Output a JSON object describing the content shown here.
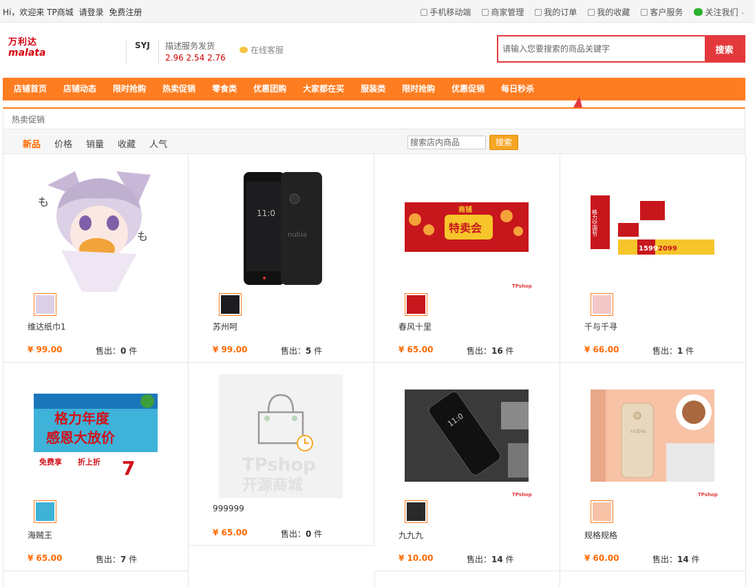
{
  "topbar": {
    "welcome": "Hi，欢迎来 TP商城",
    "login": "请登录",
    "register": "免费注册",
    "links": [
      "手机移动端",
      "商家管理",
      "我的订单",
      "我的收藏",
      "客户服务",
      "关注我们"
    ]
  },
  "header": {
    "logo_cn": "万利达",
    "logo_en": "malata",
    "shop_name": "SYJ",
    "score_label": "描述服务发货",
    "score_values": "2.96 2.54 2.76",
    "kefu": "在线客服",
    "search_placeholder": "请输入您要搜索的商品关键字",
    "search_button": "搜索"
  },
  "nav": [
    "店铺首页",
    "店铺动态",
    "限时抢购",
    "热卖促销",
    "零食类",
    "优惠团购",
    "大家都在买",
    "服装类",
    "限时抢购",
    "优惠促销",
    "每日秒杀"
  ],
  "section_tab": "热卖促销",
  "sort": {
    "options": [
      "新品",
      "价格",
      "销量",
      "收藏",
      "人气"
    ],
    "shop_search_placeholder": "搜索店内商品",
    "shop_search_button": "搜索"
  },
  "sold_label": "售出：",
  "sold_unit": " 件",
  "products": [
    {
      "name": "维达纸巾1",
      "price": "¥ 99.00",
      "sold": "0"
    },
    {
      "name": "苏州呵",
      "price": "¥ 99.00",
      "sold": "5"
    },
    {
      "name": "春风十里",
      "price": "¥ 65.00",
      "sold": "16"
    },
    {
      "name": "千与千寻",
      "price": "¥ 66.00",
      "sold": "1"
    },
    {
      "name": "海贼王",
      "price": "¥ 65.00",
      "sold": "7"
    },
    {
      "name": "999999",
      "price": "¥ 65.00",
      "sold": "0"
    },
    {
      "name": "九九九",
      "price": "¥ 10.00",
      "sold": "14"
    },
    {
      "name": "规格规格",
      "price": "¥ 60.00",
      "sold": "14"
    }
  ],
  "images": {
    "p3_banner_top": "商铺",
    "p3_banner_main": "特卖会",
    "p4_banner": "格力空调节",
    "p4_prices": [
      "1599",
      "2099"
    ],
    "p5_line1": "格力年度",
    "p5_line2": "感恩大放价",
    "p5_left": "免费享",
    "p5_mid": "折上折",
    "p5_num": "7",
    "p6_brand": "TPshop",
    "p6_sub": "开源商城",
    "phone_brand": "nubia",
    "tp_mark": "TPshop"
  }
}
